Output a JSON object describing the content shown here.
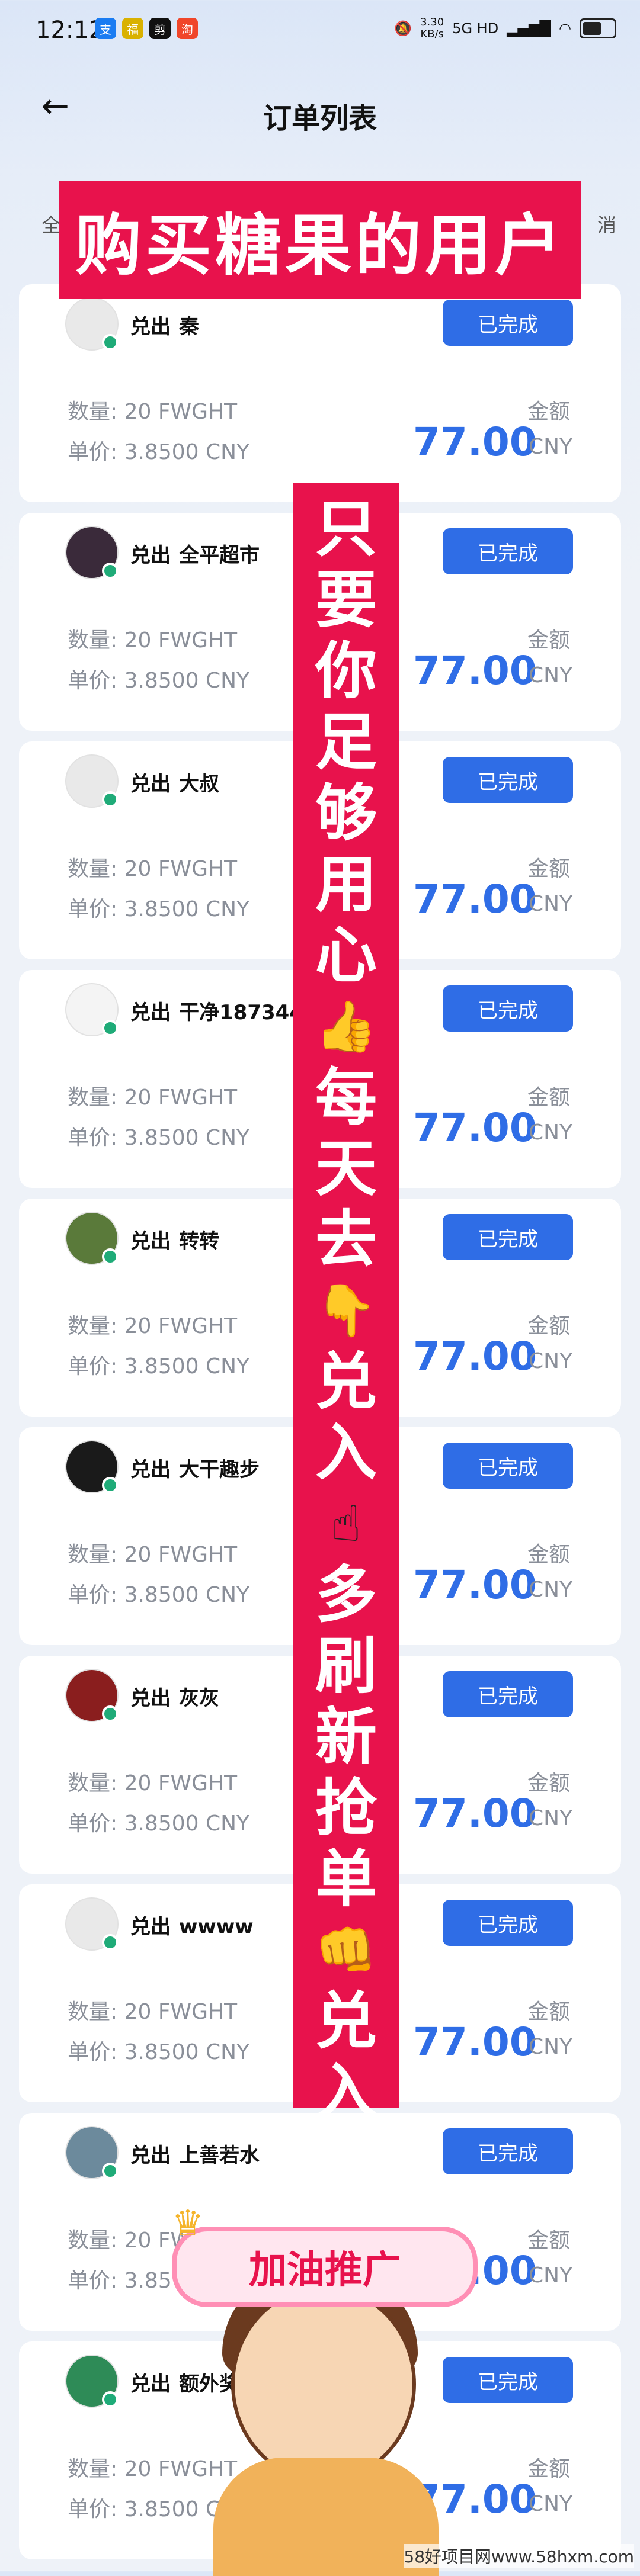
{
  "status_bar": {
    "time": "12:12",
    "apps": [
      {
        "label": "支",
        "color": "#1a7cf2"
      },
      {
        "label": "福",
        "color": "#d9b100"
      },
      {
        "label": "剪",
        "color": "#111111"
      },
      {
        "label": "淘",
        "color": "#f0462a"
      }
    ],
    "net_speed": "3.30",
    "net_unit": "KB/s",
    "signal": "5G HD"
  },
  "header": {
    "title": "订单列表",
    "back_icon": "arrow-left-icon"
  },
  "tabs": {
    "left": "全",
    "right": "消"
  },
  "overlay": {
    "banner_text": "购买糖果的用户",
    "vertical_text": [
      "只",
      "要",
      "你",
      "足",
      "够",
      "用",
      "心",
      "👍",
      "每",
      "天",
      "去",
      "👇",
      "兑",
      "入",
      "☝",
      "多",
      "刷",
      "新",
      "抢",
      "单",
      "👊",
      "兑",
      "入"
    ],
    "sticker_text": "加油推广",
    "watermark": "58好项目网www.58hxm.com"
  },
  "orders": [
    {
      "action": "兑出",
      "name": "秦",
      "status": "已完成",
      "qty": "数量: 20 FWGHT",
      "price": "单价: 3.8500 CNY",
      "amount_label": "金额",
      "amount": "77.00",
      "currency": "CNY",
      "avatar": "#e9e9e9"
    },
    {
      "action": "兑出",
      "name": "全平超市",
      "status": "已完成",
      "qty": "数量: 20 FWGHT",
      "price": "单价: 3.8500 CNY",
      "amount_label": "金额",
      "amount": "77.00",
      "currency": "CNY",
      "avatar": "#3a2a3a"
    },
    {
      "action": "兑出",
      "name": "大叔",
      "status": "已完成",
      "qty": "数量: 20 FWGHT",
      "price": "单价: 3.8500 CNY",
      "amount_label": "金额",
      "amount": "77.00",
      "currency": "CNY",
      "avatar": "#e9e9e9"
    },
    {
      "action": "兑出",
      "name": "干净1873445",
      "status": "已完成",
      "qty": "数量: 20 FWGHT",
      "price": "单价: 3.8500 CNY",
      "amount_label": "金额",
      "amount": "77.00",
      "currency": "CNY",
      "avatar": "#f4f4f4"
    },
    {
      "action": "兑出",
      "name": "转转",
      "status": "已完成",
      "qty": "数量: 20 FWGHT",
      "price": "单价: 3.8500 CNY",
      "amount_label": "金额",
      "amount": "77.00",
      "currency": "CNY",
      "avatar": "#5a7a3a"
    },
    {
      "action": "兑出",
      "name": "大干趣步",
      "status": "已完成",
      "qty": "数量: 20 FWGHT",
      "price": "单价: 3.8500 CNY",
      "amount_label": "金额",
      "amount": "77.00",
      "currency": "CNY",
      "avatar": "#1a1a1a"
    },
    {
      "action": "兑出",
      "name": "灰灰",
      "status": "已完成",
      "qty": "数量: 20 FWGHT",
      "price": "单价: 3.8500 CNY",
      "amount_label": "金额",
      "amount": "77.00",
      "currency": "CNY",
      "avatar": "#8a1e1e"
    },
    {
      "action": "兑出",
      "name": "wwww",
      "status": "已完成",
      "qty": "数量: 20 FWGHT",
      "price": "单价: 3.8500 CNY",
      "amount_label": "金额",
      "amount": "77.00",
      "currency": "CNY",
      "avatar": "#e9e9e9"
    },
    {
      "action": "兑出",
      "name": "上善若水",
      "status": "已完成",
      "qty": "数量: 20 FWGHT",
      "price": "单价: 3.85",
      "amount_label": "金额",
      "amount": "77.00",
      "currency": "CNY",
      "avatar": "#6c8a9c"
    },
    {
      "action": "兑出",
      "name": "额外奖",
      "status": "已完成",
      "qty": "数量: 20 FWGHT",
      "price": "单价: 3.8500 CNY",
      "amount_label": "金额",
      "amount": "77.00",
      "currency": "CNY",
      "avatar": "#2e8b57"
    }
  ]
}
